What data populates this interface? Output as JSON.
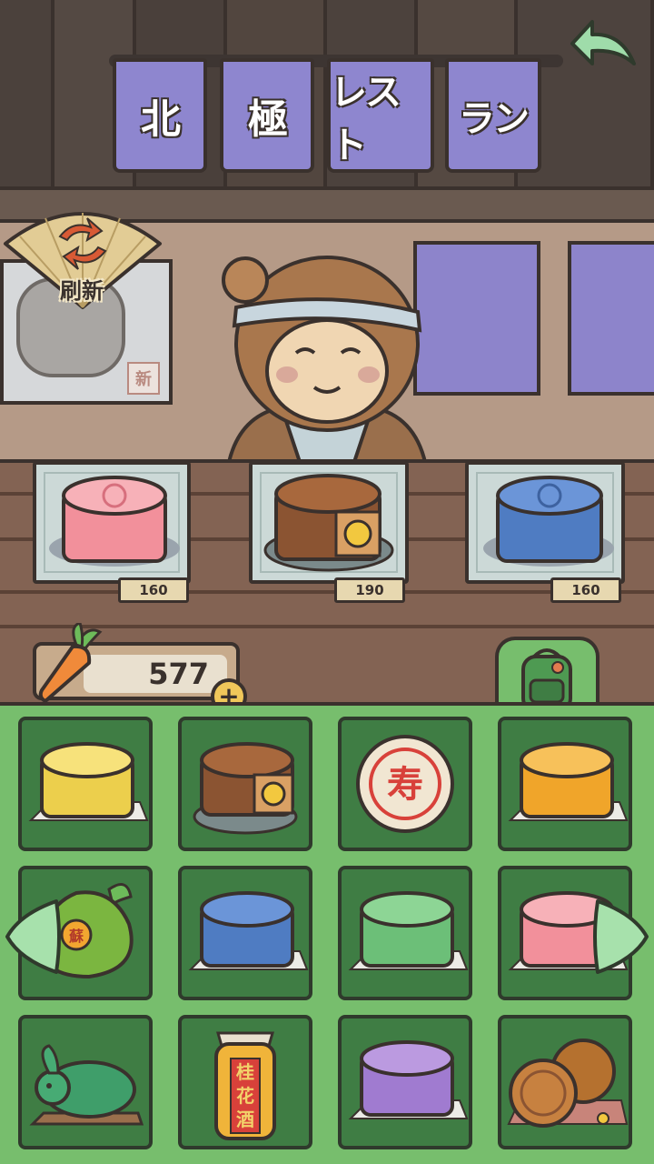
{
  "restaurant_sign": {
    "panels": [
      "北",
      "極",
      "レスト",
      "ラン"
    ]
  },
  "refresh": {
    "label": "刷新",
    "icon": "refresh-arrows-icon"
  },
  "poster": {
    "stamp": "新"
  },
  "shop": {
    "trays": [
      {
        "item": "pink-mooncake",
        "price": "160"
      },
      {
        "item": "chocolate-mooncake-sliced",
        "price": "190"
      },
      {
        "item": "blue-mooncake",
        "price": "160"
      }
    ]
  },
  "currency": {
    "icon": "carrot-icon",
    "amount": "577",
    "add_label": "+"
  },
  "inventory": {
    "tab_icon": "backpack-icon",
    "items": [
      "yellow-mooncake",
      "chocolate-mooncake-sliced",
      "shou-longevity-mooncake",
      "orange-mooncake",
      "pomelo",
      "blue-mooncake",
      "green-mooncake",
      "pink-mooncake",
      "jade-rabbit",
      "osmanthus-wine-jar",
      "purple-mooncake",
      "baked-mooncakes-with-osmanthus"
    ],
    "shou_char": "寿",
    "pomelo_char": "蘇",
    "wine_label": [
      "桂",
      "花",
      "酒"
    ]
  },
  "colors": {
    "panel_green": "#77be6d",
    "slot_green": "#3f7d44",
    "noren_purple": "#8e86cf",
    "outline": "#3a312d"
  }
}
